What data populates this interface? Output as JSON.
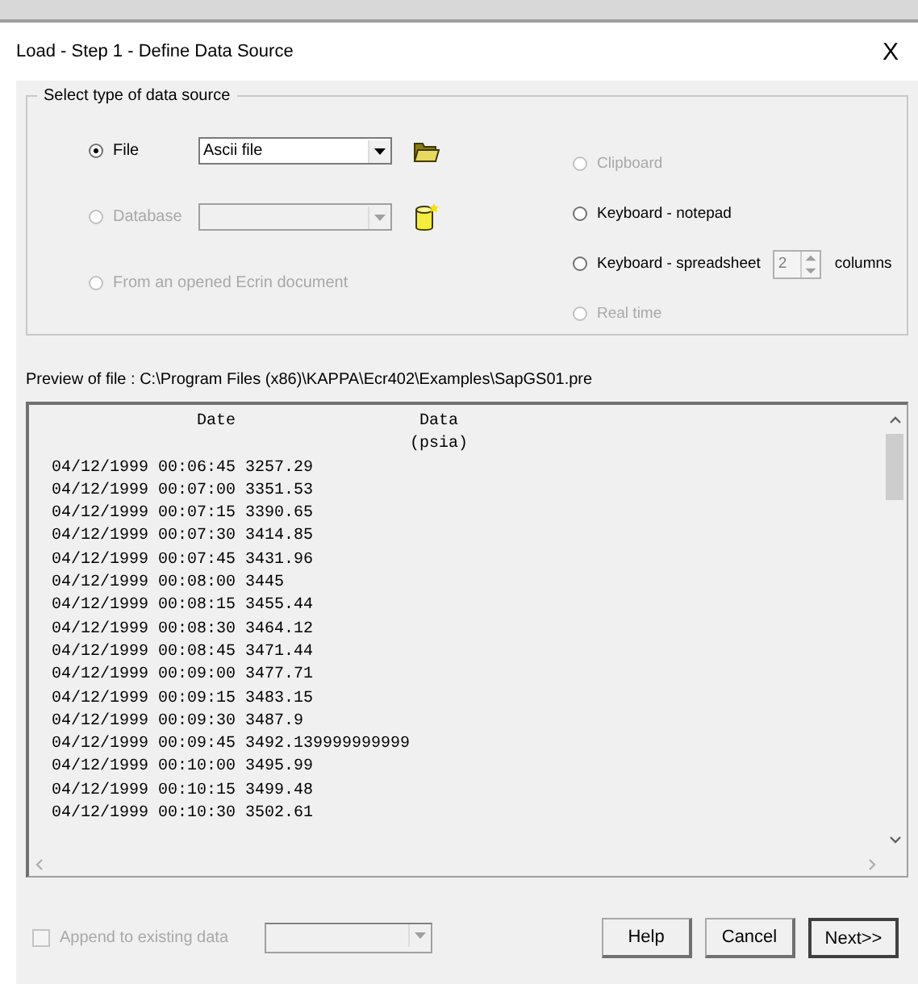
{
  "window": {
    "title": "Load - Step 1 - Define Data Source",
    "close": "X"
  },
  "source_group": {
    "title": "Select type of data source",
    "left_options": [
      {
        "kind": "combo",
        "label": "File",
        "selected": true,
        "disabled": false,
        "value": "Ascii file"
      },
      {
        "kind": "combo",
        "label": "Database",
        "selected": false,
        "disabled": true
      },
      {
        "kind": "plain",
        "label": "From an opened Ecrin document",
        "selected": false,
        "disabled": true
      }
    ],
    "right_options": [
      {
        "kind": "plain",
        "label": "Clipboard",
        "selected": false,
        "disabled": true
      },
      {
        "kind": "plain",
        "label": "Keyboard - notepad",
        "selected": false,
        "disabled": false
      },
      {
        "kind": "spin",
        "label": "Keyboard - spreadsheet",
        "selected": false,
        "disabled": false,
        "spin_value": "2",
        "suffix": "columns"
      },
      {
        "kind": "plain",
        "label": "Real time",
        "selected": false,
        "disabled": true
      }
    ]
  },
  "preview": {
    "label": "Preview of file : C:\\Program Files (x86)\\KAPPA\\Ecr402\\Examples\\SapGS01.pre",
    "columns": [
      {
        "label": "Date"
      },
      {
        "label": "Data",
        "unit": "(psia)"
      }
    ],
    "rows": [
      "04/12/1999 00:06:45 3257.29",
      "04/12/1999 00:07:00 3351.53",
      "04/12/1999 00:07:15 3390.65",
      "04/12/1999 00:07:30 3414.85",
      "04/12/1999 00:07:45 3431.96",
      "04/12/1999 00:08:00 3445",
      "04/12/1999 00:08:15 3455.44",
      "04/12/1999 00:08:30 3464.12",
      "04/12/1999 00:08:45 3471.44",
      "04/12/1999 00:09:00 3477.71",
      "04/12/1999 00:09:15 3483.15",
      "04/12/1999 00:09:30 3487.9",
      "04/12/1999 00:09:45 3492.139999999999",
      "04/12/1999 00:10:00 3495.99",
      "04/12/1999 00:10:15 3499.48",
      "04/12/1999 00:10:30 3502.61"
    ]
  },
  "footer": {
    "append": {
      "label": "Append to existing data",
      "checked": false,
      "disabled": true
    },
    "buttons": [
      {
        "label": "Help",
        "default": false
      },
      {
        "label": "Cancel",
        "default": false
      },
      {
        "label": "Next>>",
        "default": true
      }
    ]
  }
}
